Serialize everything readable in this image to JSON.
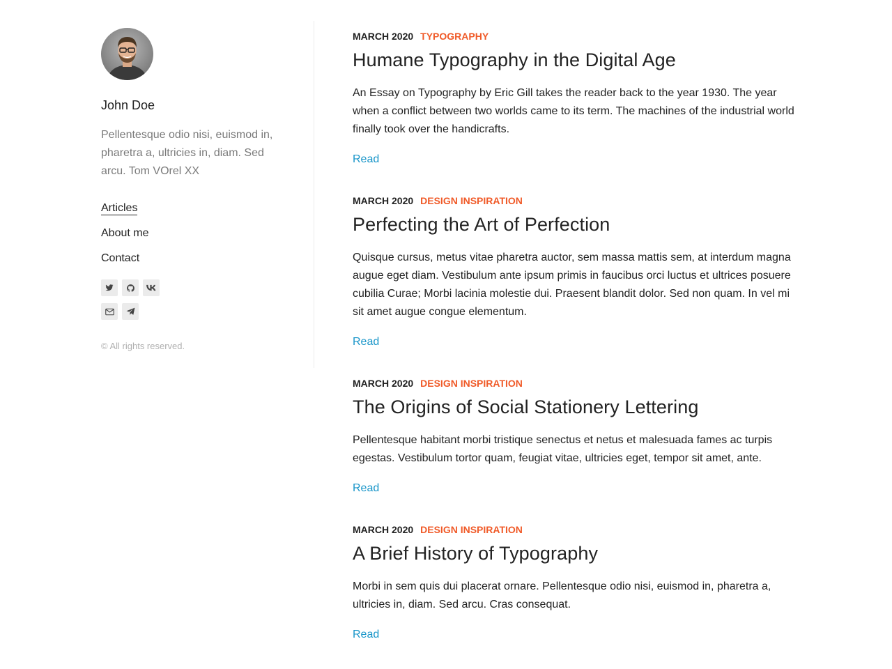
{
  "author": {
    "name": "John Doe",
    "bio": "Pellentesque odio nisi, euismod in, pharetra a, ultricies in, diam. Sed arcu. Tom VOrel XX"
  },
  "menu": [
    {
      "label": "Articles",
      "active": true
    },
    {
      "label": "About me",
      "active": false
    },
    {
      "label": "Contact",
      "active": false
    }
  ],
  "social": [
    "twitter-icon",
    "github-icon",
    "vk-icon",
    "email-icon",
    "telegram-icon"
  ],
  "copyright": "© All rights reserved.",
  "colors": {
    "accent_category": "#f05a28",
    "link": "#1a96c9",
    "text": "#222222",
    "muted": "#7a7a7a"
  },
  "articles": [
    {
      "date": "MARCH 2020",
      "category": "TYPOGRAPHY",
      "title": "Humane Typography in the Digital Age",
      "excerpt": "An Essay on Typography by Eric Gill takes the reader back to the year 1930. The year when a conflict between two worlds came to its term. The machines of the industrial world finally took over the handicrafts.",
      "read_label": "Read"
    },
    {
      "date": "MARCH 2020",
      "category": "DESIGN INSPIRATION",
      "title": "Perfecting the Art of Perfection",
      "excerpt": "Quisque cursus, metus vitae pharetra auctor, sem massa mattis sem, at interdum magna augue eget diam. Vestibulum ante ipsum primis in faucibus orci luctus et ultrices posuere cubilia Curae; Morbi lacinia molestie dui. Praesent blandit dolor. Sed non quam. In vel mi sit amet augue congue elementum.",
      "read_label": "Read"
    },
    {
      "date": "MARCH 2020",
      "category": "DESIGN INSPIRATION",
      "title": "The Origins of Social Stationery Lettering",
      "excerpt": "Pellentesque habitant morbi tristique senectus et netus et malesuada fames ac turpis egestas. Vestibulum tortor quam, feugiat vitae, ultricies eget, tempor sit amet, ante.",
      "read_label": "Read"
    },
    {
      "date": "MARCH 2020",
      "category": "DESIGN INSPIRATION",
      "title": "A Brief History of Typography",
      "excerpt": "Morbi in sem quis dui placerat ornare. Pellentesque odio nisi, euismod in, pharetra a, ultricies in, diam. Sed arcu. Cras consequat.",
      "read_label": "Read"
    }
  ]
}
